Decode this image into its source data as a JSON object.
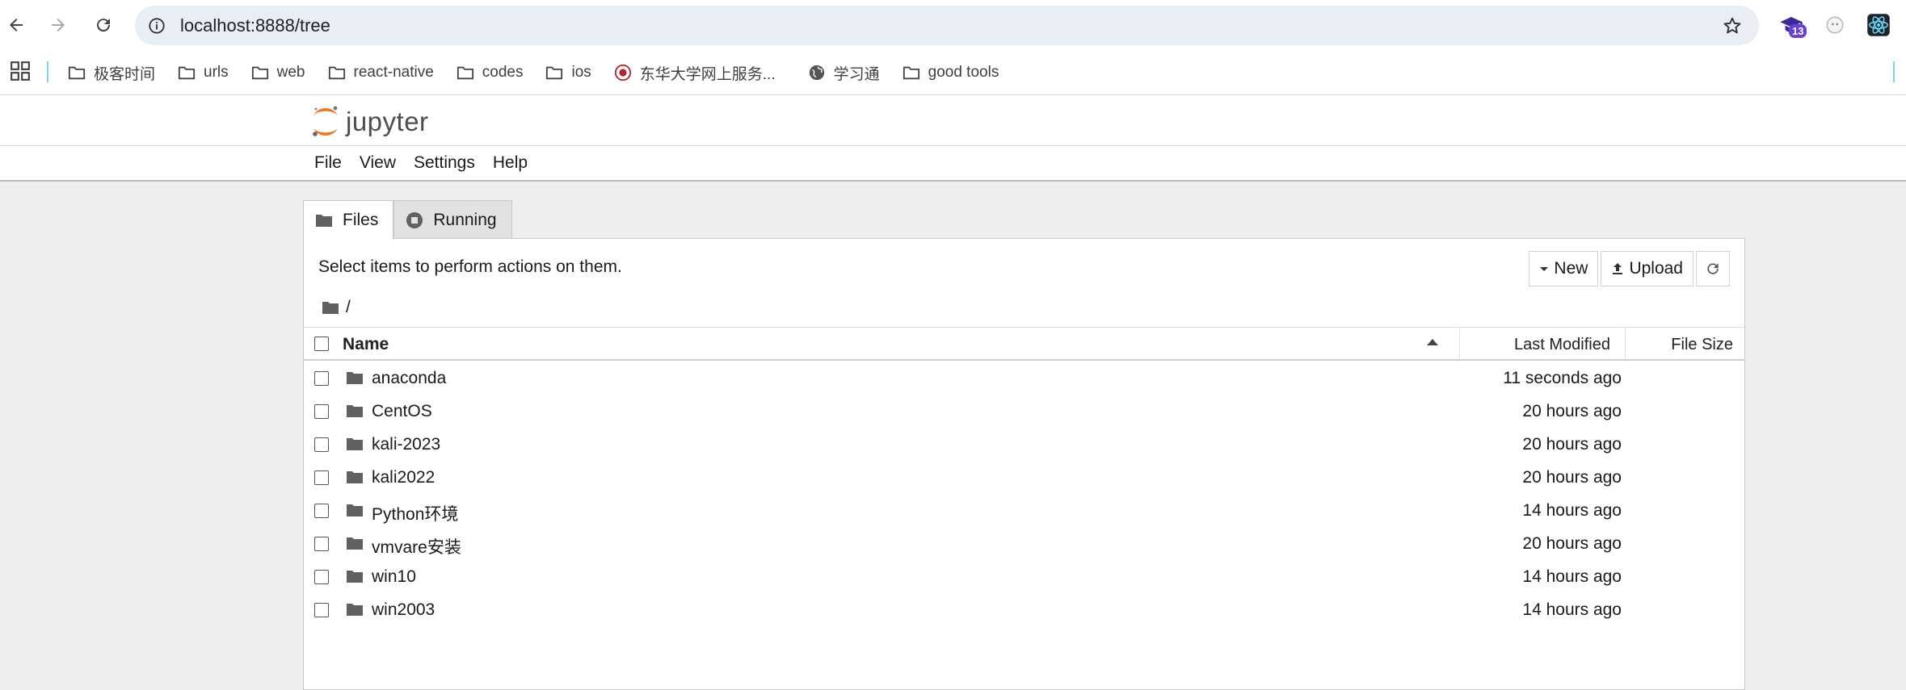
{
  "browser": {
    "url": "localhost:8888/tree",
    "extension_badge": "13",
    "nav_icons": [
      "back-arrow-icon",
      "forward-arrow-icon",
      "reload-icon"
    ],
    "bookmarks": [
      {
        "label": "极客时间",
        "icon": "folder-icon"
      },
      {
        "label": "urls",
        "icon": "folder-icon"
      },
      {
        "label": "web",
        "icon": "folder-icon"
      },
      {
        "label": "react-native",
        "icon": "folder-icon"
      },
      {
        "label": "codes",
        "icon": "folder-icon"
      },
      {
        "label": "ios",
        "icon": "folder-icon"
      },
      {
        "label": "东华大学网上服务...",
        "icon": "university-seal-icon"
      },
      {
        "label": "学习通",
        "icon": "globe-icon"
      },
      {
        "label": "good tools",
        "icon": "folder-icon"
      }
    ]
  },
  "jupyter": {
    "logo_text": "jupyter",
    "menu": [
      "File",
      "View",
      "Settings",
      "Help"
    ],
    "tabs": [
      {
        "label": "Files",
        "active": true,
        "icon": "folder-icon"
      },
      {
        "label": "Running",
        "active": false,
        "icon": "stop-circle-icon"
      }
    ],
    "select_hint": "Select items to perform actions on them.",
    "actions": {
      "new_label": "New",
      "upload_label": "Upload",
      "refresh_icon": "refresh-icon"
    },
    "breadcrumb": "/",
    "columns": {
      "name": "Name",
      "last_modified": "Last Modified",
      "file_size": "File Size"
    },
    "files": [
      {
        "name": "anaconda",
        "modified": "11 seconds ago"
      },
      {
        "name": "CentOS",
        "modified": "20 hours ago"
      },
      {
        "name": "kali-2023",
        "modified": "20 hours ago"
      },
      {
        "name": "kali2022",
        "modified": "20 hours ago"
      },
      {
        "name": "Python环境",
        "modified": "14 hours ago"
      },
      {
        "name": "vmvare安装",
        "modified": "20 hours ago"
      },
      {
        "name": "win10",
        "modified": "14 hours ago"
      },
      {
        "name": "win2003",
        "modified": "14 hours ago"
      }
    ]
  },
  "colors": {
    "omnibox_bg": "#e9eef6",
    "jupyter_orange": "#f37726",
    "page_bg": "#eeeeee",
    "folder_icon": "#616161"
  }
}
